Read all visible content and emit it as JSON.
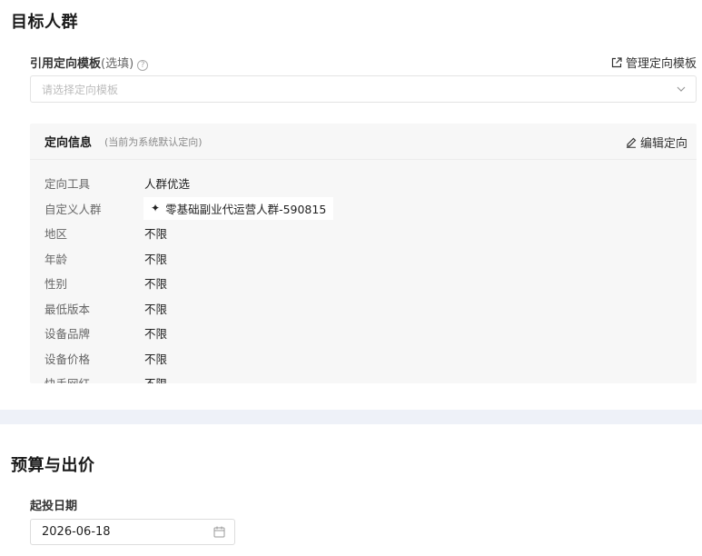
{
  "audience": {
    "title": "目标人群",
    "template_label": "引用定向模板",
    "template_optional": "(选填)",
    "help_glyph": "?",
    "manage_link": "管理定向模板",
    "select_placeholder": "请选择定向模板",
    "info": {
      "title": "定向信息",
      "note": "(当前为系统默认定向)",
      "edit_link": "编辑定向",
      "rows": [
        {
          "label": "定向工具",
          "value": "人群优选"
        },
        {
          "label": "自定义人群",
          "value": "零基础副业代运营人群-590815",
          "icon": "sparkle-icon",
          "icon_glyph": "✦"
        },
        {
          "label": "地区",
          "value": "不限"
        },
        {
          "label": "年龄",
          "value": "不限"
        },
        {
          "label": "性别",
          "value": "不限"
        },
        {
          "label": "最低版本",
          "value": "不限"
        },
        {
          "label": "设备品牌",
          "value": "不限"
        },
        {
          "label": "设备价格",
          "value": "不限"
        },
        {
          "label": "快手网红",
          "value": "不限"
        }
      ]
    }
  },
  "budget": {
    "title": "预算与出价",
    "start_date_label": "起投日期",
    "start_date_value": "2026-06-18"
  }
}
